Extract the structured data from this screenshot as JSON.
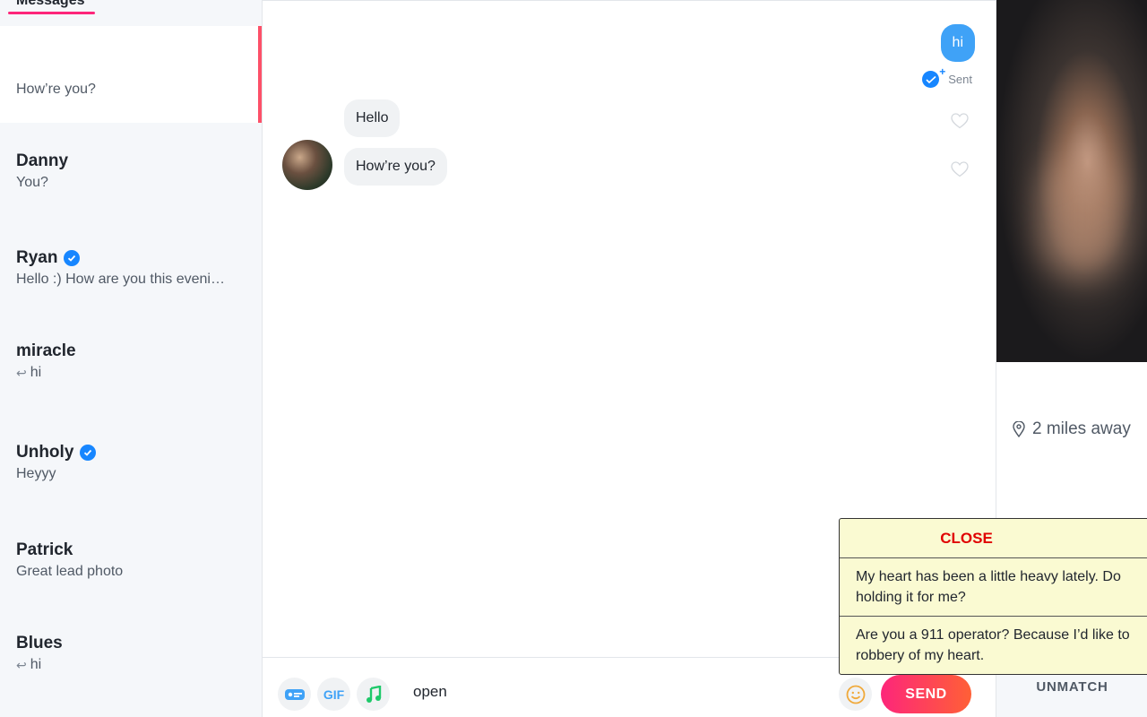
{
  "sidebar": {
    "tab_label": "Messages",
    "conversations": [
      {
        "name": "",
        "preview": "How’re you?",
        "active": true
      },
      {
        "name": "Danny",
        "preview": "You?"
      },
      {
        "name": "Ryan",
        "preview": "Hello :) How are you this eveni…",
        "verified": true
      },
      {
        "name": "miracle",
        "preview": "hi",
        "replied": true
      },
      {
        "name": "Unholy",
        "preview": "Heyyy",
        "verified": true
      },
      {
        "name": "Patrick",
        "preview": "Great lead photo"
      },
      {
        "name": "Blues",
        "preview": "hi",
        "replied": true
      }
    ]
  },
  "chat": {
    "messages": [
      {
        "from": "me",
        "text": "hi"
      },
      {
        "from": "them",
        "text": "Hello"
      },
      {
        "from": "them",
        "text": "How’re you?"
      }
    ],
    "sent_label": "Sent",
    "composer": {
      "gif_label": "GIF",
      "input_value": "open",
      "send_label": "SEND"
    }
  },
  "profile": {
    "distance": "2 miles away",
    "unmatch_label": "UNMATCH"
  },
  "popup": {
    "close_label": "CLOSE",
    "suggestions": [
      "My heart has been a little heavy lately. Do",
      "holding it for me?",
      "Are you a 911 operator? Because I’d like to",
      "robbery of my heart."
    ]
  },
  "colors": {
    "accent": "#fd5068",
    "brand_gradient_start": "#fd267a",
    "brand_gradient_end": "#ff6036",
    "my_bubble": "#3fa2f7",
    "verified": "#1786ff",
    "close_text": "#e00000",
    "popup_bg": "#fafad2"
  }
}
